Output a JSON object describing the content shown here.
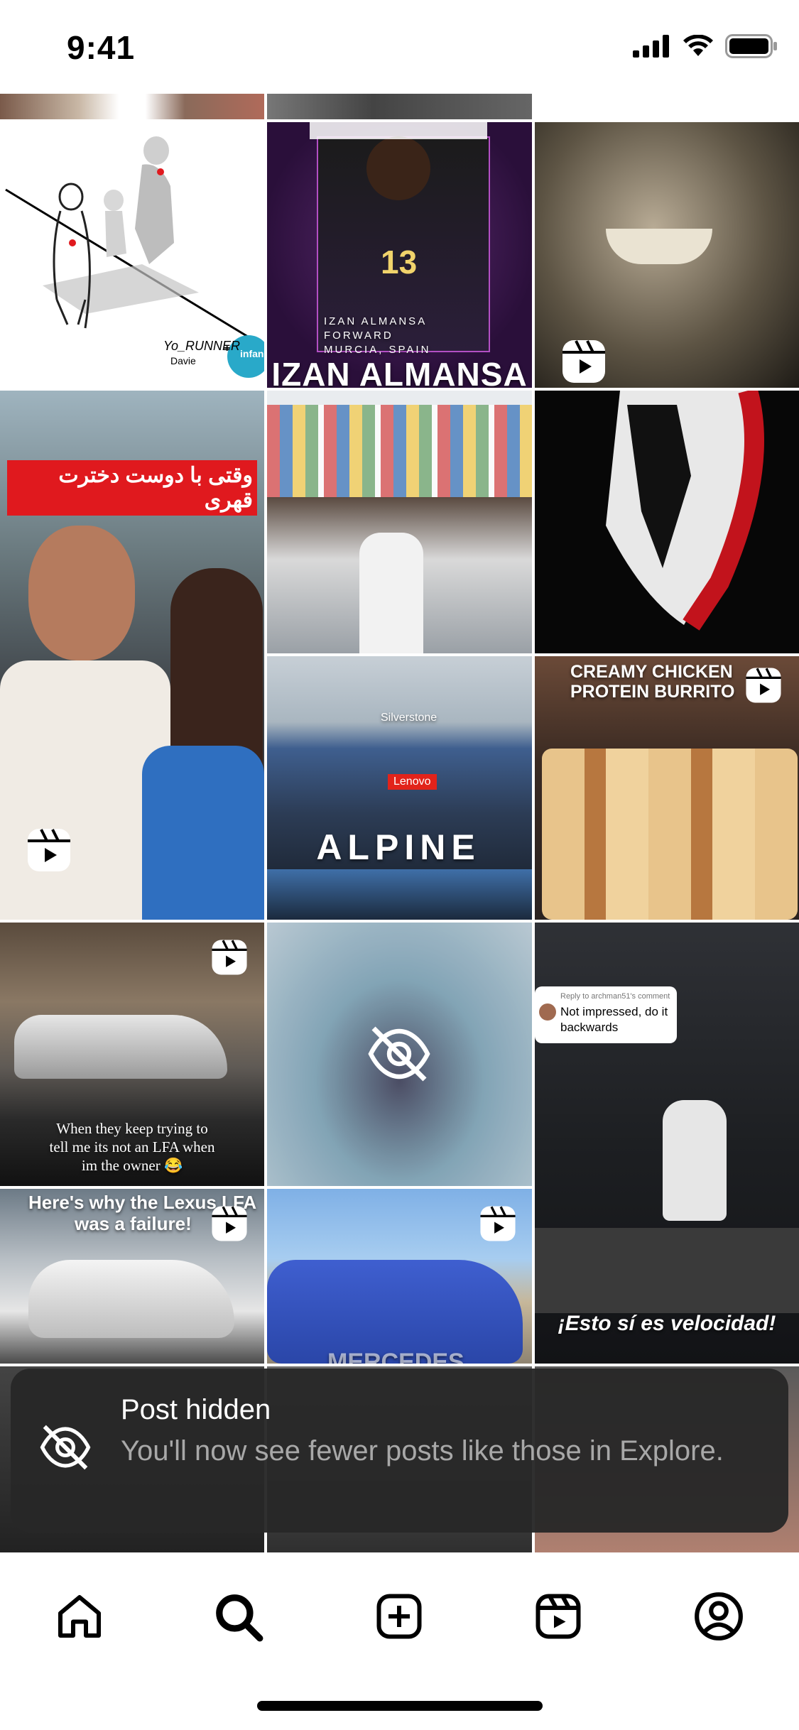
{
  "status_bar": {
    "time": "9:41"
  },
  "posts": [
    {
      "id": "yo-runner-art",
      "caption_lines": [
        "Yo_RUNNER",
        "Davie",
        "+",
        "infan"
      ]
    },
    {
      "id": "izan-almansa",
      "caption_lines": [
        "IZAN ALMANSA",
        "FORWARD",
        "MURCIA, SPAIN",
        "IZAN ALMANSA"
      ]
    },
    {
      "id": "persian-couple",
      "caption": "وقتی با دوست دخترت قهری"
    },
    {
      "id": "alpine-f1",
      "caption_lines": [
        "Silverstone",
        "Lenovo",
        "ALPINE"
      ]
    },
    {
      "id": "protein-burrito",
      "caption_lines": [
        "CREAMY CHICKEN",
        "PROTEIN BURRITO"
      ]
    },
    {
      "id": "lexus-lfa-owner",
      "caption_lines": [
        "When they keep trying to",
        "tell me its not an LFA when",
        "im the owner 😂"
      ]
    },
    {
      "id": "gym-velocidad",
      "comment_header": "Reply to archman51's comment",
      "comment_text": [
        "Not impressed, do it",
        "backwards"
      ],
      "caption": "¡Esto sí es velocidad!"
    },
    {
      "id": "lexus-lfa-failure",
      "caption_lines": [
        "Here's why the Lexus LFA",
        "was a failure!"
      ]
    },
    {
      "id": "mercedes-a-class",
      "caption": "MERCEDES"
    }
  ],
  "hidden_post_icon": "eye-slash-icon",
  "toast": {
    "icon": "eye-slash-icon",
    "title": "Post hidden",
    "message": "You'll now see fewer posts like those in Explore."
  },
  "tabs": [
    {
      "name": "home",
      "icon": "home-icon"
    },
    {
      "name": "search",
      "icon": "search-icon"
    },
    {
      "name": "create",
      "icon": "plus-square-icon"
    },
    {
      "name": "reels",
      "icon": "reels-icon"
    },
    {
      "name": "profile",
      "icon": "profile-icon"
    }
  ],
  "colors": {
    "accent_red": "#e0191e",
    "toast_bg": "#282828",
    "purple": "#7b2a8f"
  }
}
